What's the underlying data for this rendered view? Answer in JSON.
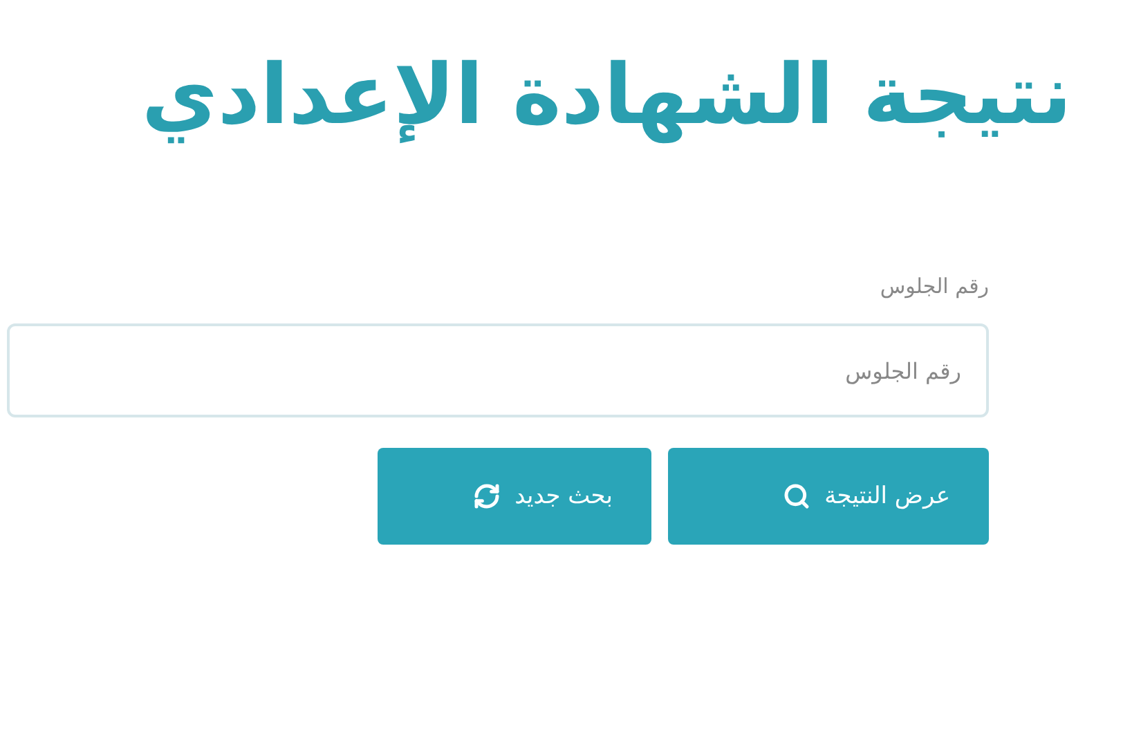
{
  "title": "نتيجة الشهادة الإعدادي",
  "form": {
    "label": "رقم الجلوس",
    "placeholder": "رقم الجلوس"
  },
  "buttons": [
    {
      "kind": "search",
      "label": "عرض النتيجة"
    },
    {
      "kind": "refresh",
      "label": "بحث جديد"
    }
  ]
}
